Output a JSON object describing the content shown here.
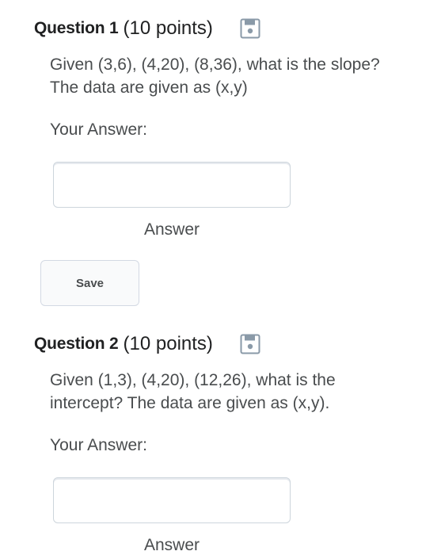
{
  "questions": [
    {
      "number_label": "Question 1",
      "points_label": "(10 points)",
      "save_icon": "floppy-disk-icon",
      "text": "Given (3,6),  (4,20),  (8,36), what is the slope? The data are given as (x,y)",
      "your_answer_label": "Your Answer:",
      "answer_value": "",
      "answer_caption": "Answer"
    },
    {
      "number_label": "Question 2",
      "points_label": "(10 points)",
      "save_icon": "floppy-disk-icon",
      "text": "Given (1,3),  (4,20),  (12,26), what is the intercept? The data are given as (x,y).",
      "your_answer_label": "Your Answer:",
      "answer_value": "",
      "answer_caption": "Answer"
    }
  ],
  "save_button": {
    "label": "Save"
  },
  "colors": {
    "heading": "#202122",
    "body_text": "#494c4e",
    "input_border": "#cdd5dc",
    "icon": "#8a9aa8"
  }
}
